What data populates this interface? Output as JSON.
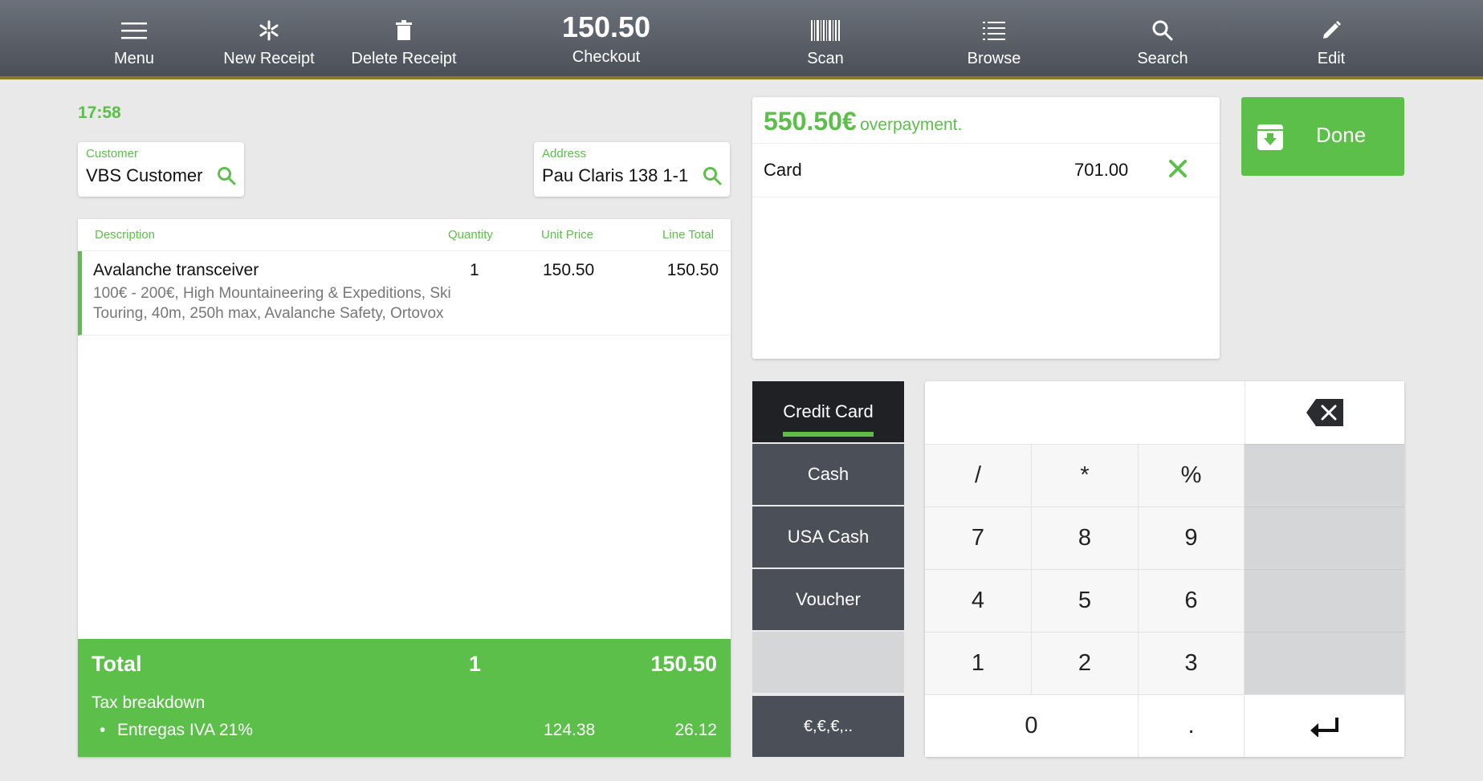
{
  "toolbar": {
    "menu_label": "Menu",
    "new_receipt_label": "New Receipt",
    "delete_receipt_label": "Delete Receipt",
    "checkout_amount": "150.50",
    "checkout_label": "Checkout",
    "scan_label": "Scan",
    "browse_label": "Browse",
    "search_label": "Search",
    "edit_label": "Edit"
  },
  "time": "17:58",
  "customer": {
    "label": "Customer",
    "value": "VBS Customer"
  },
  "address": {
    "label": "Address",
    "value": "Pau Claris 138 1-1"
  },
  "receipt": {
    "columns": {
      "description": "Description",
      "quantity": "Quantity",
      "unit_price": "Unit Price",
      "line_total": "Line Total"
    },
    "items": [
      {
        "name": "Avalanche transceiver",
        "details": "100€ - 200€, High Mountaineering & Expeditions, Ski Touring, 40m, 250h max, Avalanche Safety, Ortovox",
        "quantity": "1",
        "unit_price": "150.50",
        "line_total": "150.50"
      }
    ],
    "total_label": "Total",
    "total_quantity": "1",
    "total_amount": "150.50",
    "tax_breakdown_label": "Tax breakdown",
    "tax_lines": [
      {
        "name": "Entregas IVA 21%",
        "base": "124.38",
        "tax": "26.12"
      }
    ]
  },
  "payment": {
    "overpayment_amount": "550.50€",
    "overpayment_text": "overpayment.",
    "lines": [
      {
        "method": "Card",
        "amount": "701.00"
      }
    ]
  },
  "done_label": "Done",
  "methods": [
    "Credit Card",
    "Cash",
    "USA Cash",
    "Voucher",
    "",
    "€,€,€,.."
  ],
  "keypad": {
    "row1": [
      "/",
      "*",
      "%"
    ],
    "row2": [
      "7",
      "8",
      "9"
    ],
    "row3": [
      "4",
      "5",
      "6"
    ],
    "row4": [
      "1",
      "2",
      "3"
    ],
    "zero": "0",
    "dot": "."
  },
  "colors": {
    "accent": "#5cbf4a",
    "toolbar": "#555a62",
    "method_bg": "#4b5058",
    "method_active": "#1f2124"
  }
}
